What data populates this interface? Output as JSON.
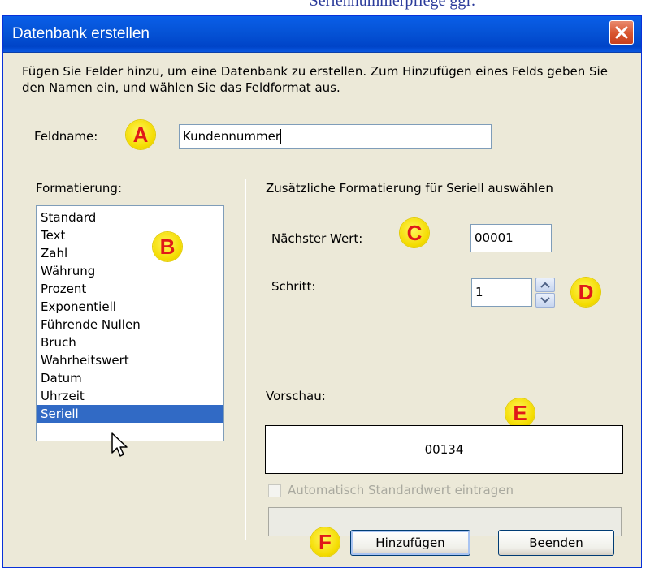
{
  "top_text": "Seriennummerpflege ggf.",
  "dialog": {
    "title": "Datenbank erstellen",
    "intro": "Fügen Sie Felder hinzu, um eine Datenbank zu erstellen. Zum Hinzufügen eines Felds geben Sie den Namen ein, und wählen Sie das Feldformat aus.",
    "field_name_label": "Feldname:",
    "field_name_value": "Kundennummer",
    "format_label": "Formatierung:",
    "formats": [
      "Standard",
      "Text",
      "Zahl",
      "Währung",
      "Prozent",
      "Exponentiell",
      "Führende Nullen",
      "Bruch",
      "Wahrheitswert",
      "Datum",
      "Uhrzeit",
      "Seriell"
    ],
    "selected_format": "Seriell",
    "extra_format_label": "Zusätzliche Formatierung für Seriell auswählen",
    "next_value_label": "Nächster Wert:",
    "next_value": "00001",
    "step_label": "Schritt:",
    "step_value": "1",
    "preview_label": "Vorschau:",
    "preview_value": "00134",
    "auto_default_label": "Automatisch Standardwert eintragen",
    "add_button": "Hinzufügen",
    "close_button": "Beenden"
  },
  "annotations": {
    "a": "A",
    "b": "B",
    "c": "C",
    "d": "D",
    "e": "E",
    "f": "F"
  },
  "colors": {
    "titlebar": "#0553d6",
    "dialog_bg": "#ece9d8",
    "selection": "#316ac5",
    "badge": "#f4dc00",
    "badge_text": "#e01818"
  }
}
